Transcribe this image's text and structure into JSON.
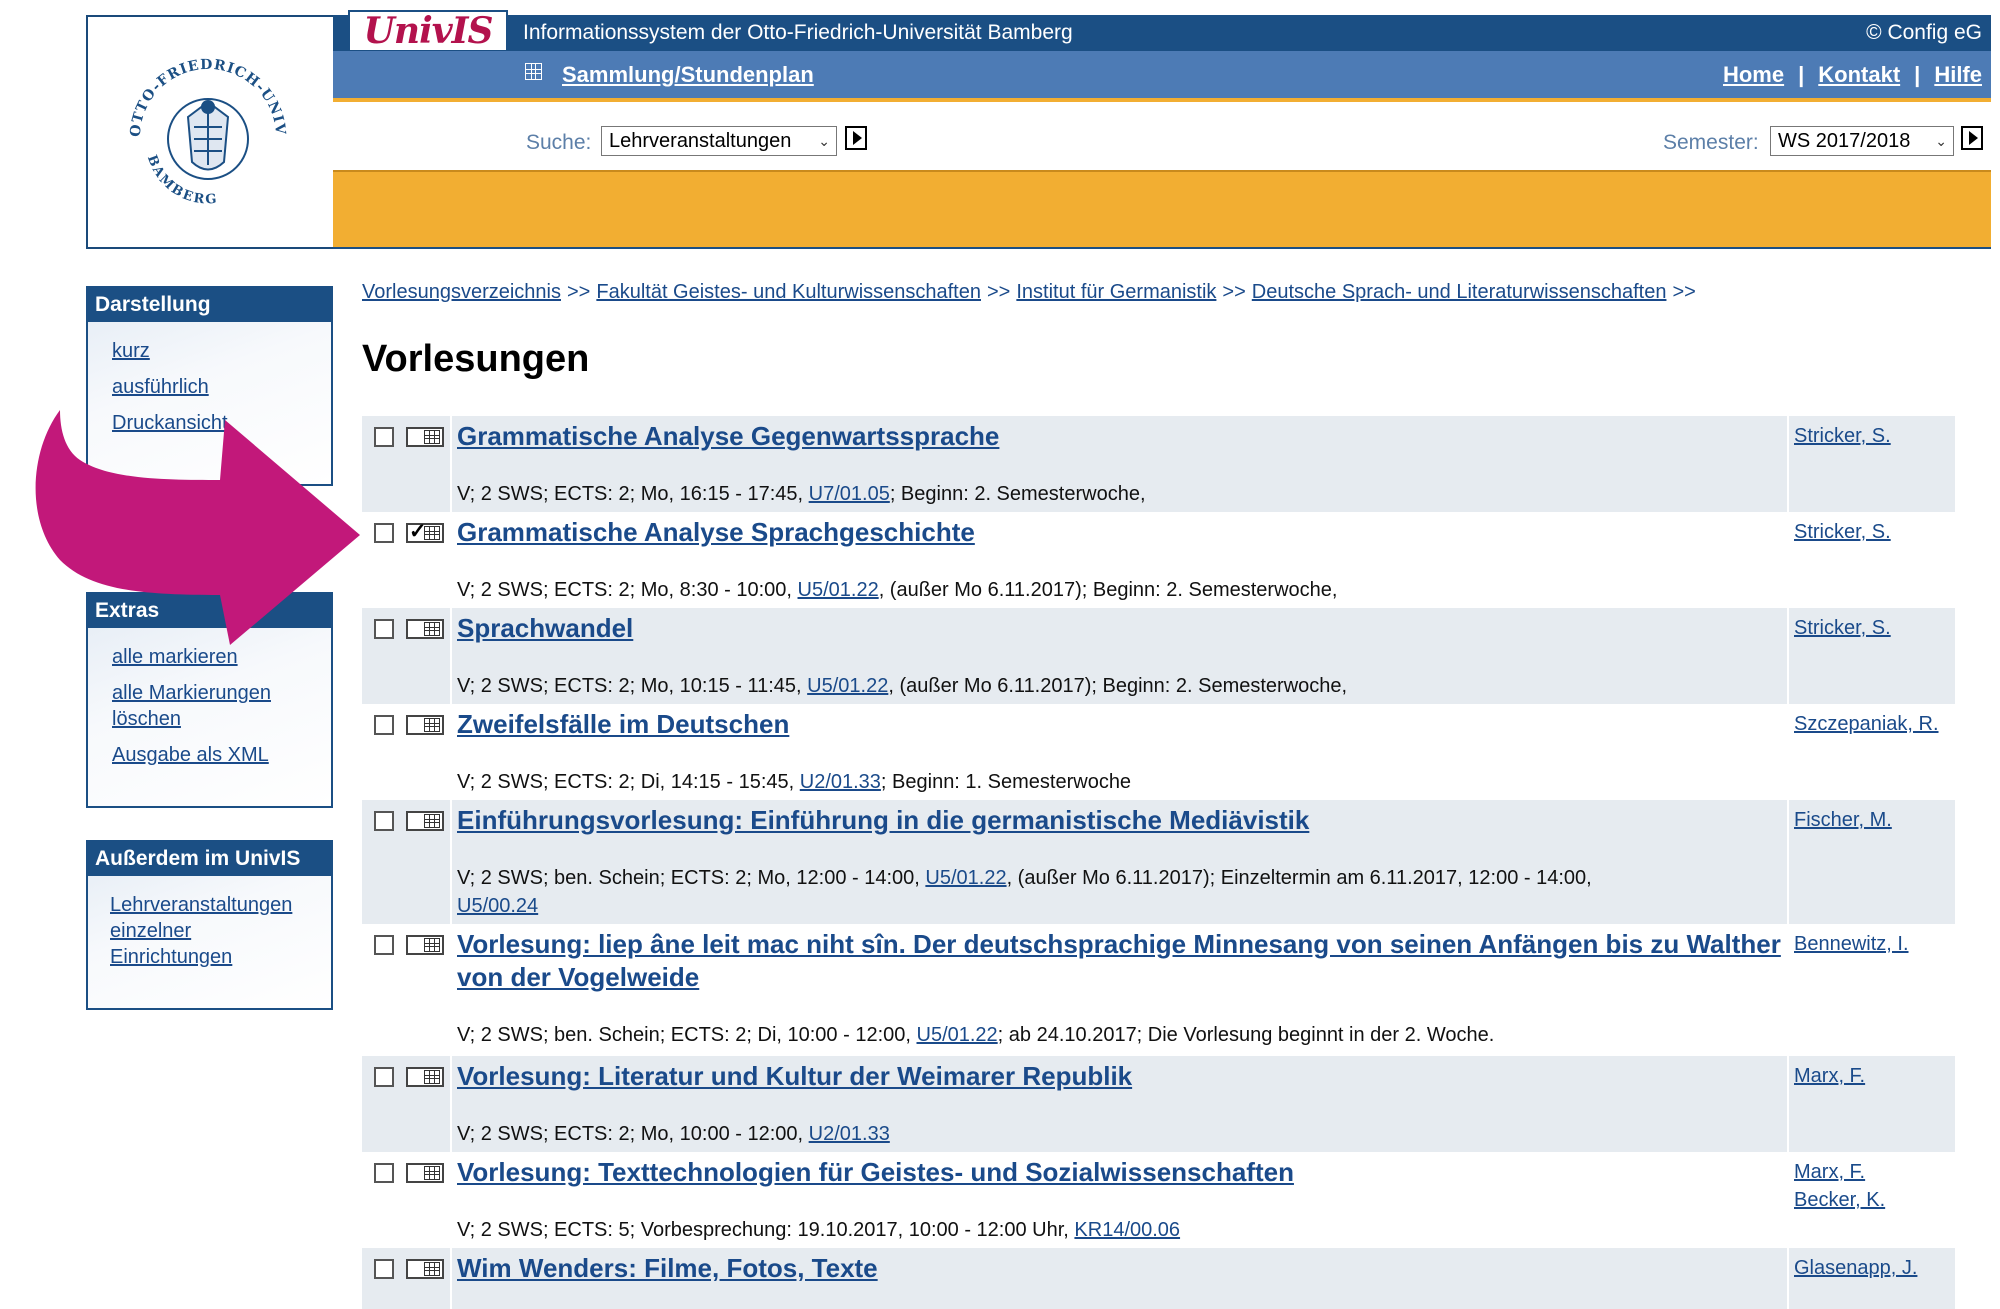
{
  "header": {
    "brand": "UnivIS",
    "system_title": "Informationssystem der Otto-Friedrich-Universität Bamberg",
    "copyright": "© Config eG",
    "sammlung": "Sammlung/Stundenplan",
    "links": {
      "home": "Home",
      "kontakt": "Kontakt",
      "hilfe": "Hilfe",
      "separator": "|"
    },
    "search_label": "Suche:",
    "search_value": "Lehrveranstaltungen",
    "semester_label": "Semester:",
    "semester_value": "WS 2017/2018",
    "colors": {
      "blue": "#1b4f84",
      "navblue": "#4d7bb5",
      "orange": "#f2ae32",
      "brand_red": "#b3124d",
      "arrow": "#c2187a"
    }
  },
  "sidebar": {
    "darstellung": {
      "title": "Darstellung",
      "items": [
        "kurz",
        "ausführlich",
        "Druckansicht"
      ]
    },
    "extras": {
      "title": "Extras",
      "items": [
        "alle markieren",
        "alle Markierungen löschen",
        "Ausgabe als XML"
      ]
    },
    "ausserdem": {
      "title": "Außerdem im UnivIS",
      "items": [
        "Lehrveranstaltungen einzelner Einrichtungen"
      ]
    }
  },
  "breadcrumb": {
    "items": [
      "Vorlesungsverzeichnis",
      "Fakultät Geistes- und Kulturwissenschaften",
      "Institut für Germanistik",
      "Deutsche Sprach- und Literaturwissenschaften"
    ],
    "separator": ">>"
  },
  "page_title": "Vorlesungen",
  "courses": [
    {
      "title": "Grammatische Analyse Gegenwartssprache",
      "lecturer": "Stricker, S.",
      "info_pre": "V; 2 SWS; ECTS: 2; Mo, 16:15 - 17:45,",
      "room": "U7/01.05",
      "info_post": "; Beginn: 2. Semesterwoche,",
      "in_plan": false
    },
    {
      "title": "Grammatische Analyse Sprachgeschichte",
      "lecturer": "Stricker, S.",
      "info_pre": "V; 2 SWS; ECTS: 2; Mo, 8:30 - 10:00,",
      "room": "U5/01.22",
      "info_post": ", (außer Mo 6.11.2017); Beginn: 2. Semesterwoche,",
      "in_plan": true
    },
    {
      "title": "Sprachwandel",
      "lecturer": "Stricker, S.",
      "info_pre": "V; 2 SWS; ECTS: 2; Mo, 10:15 - 11:45,",
      "room": "U5/01.22",
      "info_post": ", (außer Mo 6.11.2017); Beginn: 2. Semesterwoche,",
      "in_plan": false
    },
    {
      "title": "Zweifelsfälle im Deutschen",
      "lecturer": "Szczepaniak, R.",
      "info_pre": "V; 2 SWS; ECTS: 2; Di, 14:15 - 15:45,",
      "room": "U2/01.33",
      "info_post": "; Beginn: 1. Semesterwoche",
      "in_plan": false
    },
    {
      "title": "Einführungsvorlesung: Einführung in die germanistische Mediävistik",
      "lecturer": "Fischer, M.",
      "info_pre": "V; 2 SWS; ben. Schein; ECTS: 2; Mo, 12:00 - 14:00,",
      "room": "U5/01.22",
      "info_post": ", (außer Mo 6.11.2017); Einzeltermin am 6.11.2017, 12:00 - 14:00,",
      "room2": "U5/00.24",
      "in_plan": false
    },
    {
      "title": "Vorlesung: liep âne leit mac niht sîn. Der deutschsprachige Minnesang von seinen Anfängen bis zu Walther von der Vogelweide",
      "lecturer": "Bennewitz, I.",
      "info_pre": "V; 2 SWS; ben. Schein; ECTS: 2; Di, 10:00 - 12:00,",
      "room": "U5/01.22",
      "info_post": "; ab 24.10.2017; Die Vorlesung beginnt in der 2. Woche.",
      "in_plan": false
    },
    {
      "title": "Vorlesung: Literatur und Kultur der Weimarer Republik",
      "lecturer": "Marx, F.",
      "info_pre": "V; 2 SWS; ECTS: 2; Mo, 10:00 - 12:00,",
      "room": "U2/01.33",
      "info_post": "",
      "in_plan": false
    },
    {
      "title": "Vorlesung: Texttechnologien für Geistes- und Sozialwissenschaften",
      "lecturer": "Marx, F.",
      "lecturer2": "Becker, K.",
      "info_pre": "V; 2 SWS; ECTS: 5; Vorbesprechung: 19.10.2017, 10:00 - 12:00 Uhr,",
      "room": "KR14/00.06",
      "info_post": "",
      "in_plan": false
    },
    {
      "title": "Wim Wenders: Filme, Fotos, Texte",
      "lecturer": "Glasenapp, J.",
      "in_plan": false
    }
  ]
}
